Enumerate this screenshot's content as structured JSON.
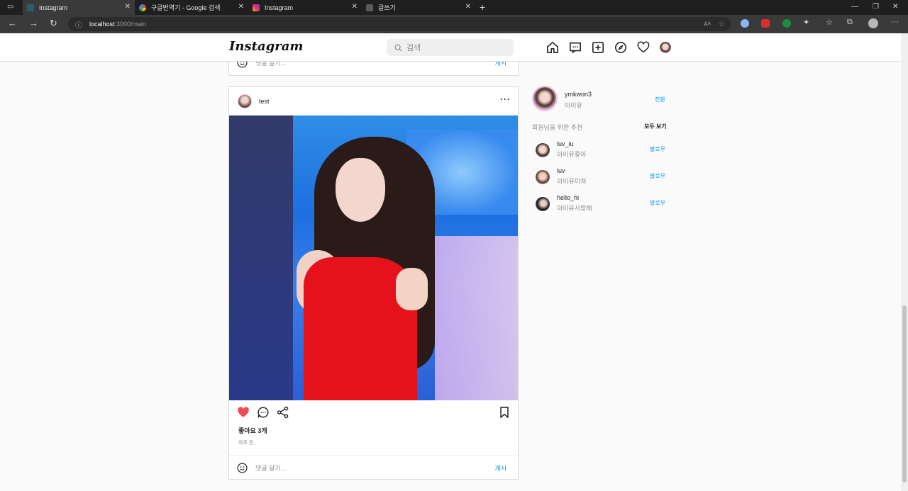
{
  "browser": {
    "tabs": [
      {
        "title": "Instagram",
        "active": true
      },
      {
        "title": "구글번역기 - Google 검색",
        "active": false
      },
      {
        "title": "Instagram",
        "active": false
      },
      {
        "title": "글쓰기",
        "active": false
      }
    ],
    "url_host": "localhost",
    "url_path": ":3000/main"
  },
  "header": {
    "logo": "Instagram",
    "search_placeholder": "검색",
    "icons": [
      "home-icon",
      "messenger-icon",
      "new-post-icon",
      "explore-icon",
      "activity-heart-icon",
      "profile-avatar"
    ]
  },
  "prev_post": {
    "comment_placeholder": "댓글 달기...",
    "post_label": "게시"
  },
  "post": {
    "username": "test",
    "more_label": "···",
    "likes_text": "좋아요 3개",
    "time_text": "하루 전",
    "comment_placeholder": "댓글 달기...",
    "post_label": "게시",
    "liked": true,
    "like_color": "#ed4956"
  },
  "sidebar": {
    "me_id": "ymkwon3",
    "me_name": "아이유",
    "switch_label": "전환",
    "suggest_title": "회원님을 위한 추천",
    "see_all": "모두 보기",
    "suggestions": [
      {
        "id": "luv_iu",
        "name": "아이유좋아",
        "follow": "팔로우"
      },
      {
        "id": "luv",
        "name": "아이유미쳐",
        "follow": "팔로우"
      },
      {
        "id": "hello_hi",
        "name": "아이유사랑해",
        "follow": "팔로우"
      }
    ]
  },
  "colors": {
    "accent": "#0095f6",
    "border": "#dbdbdb",
    "background": "#fafafa"
  }
}
